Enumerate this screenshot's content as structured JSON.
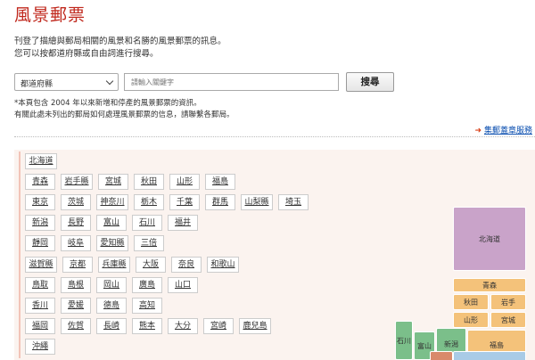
{
  "page": {
    "title": "風景郵票",
    "intro_line1": "刊登了描繪與郵局相關的風景和名勝的風景郵票的訊息。",
    "intro_line2": "您可以按都道府縣或自由詞進行搜尋。"
  },
  "search": {
    "select_value": "都道府縣",
    "placeholder": "請輸入關鍵字",
    "button_label": "搜尋"
  },
  "notes": {
    "line1": "*本頁包含 2004 年以來新增和停產的風景郵票的資訊。",
    "line2": "有關此處未列出的郵局如何處理風景郵票的信息，請聯繫各郵局。"
  },
  "service_link": {
    "label": "集郵蓋章服務",
    "icon": "arrow-right-icon"
  },
  "prefecture_rows": [
    [
      "北海道"
    ],
    [
      "青森",
      "岩手縣",
      "宮城",
      "秋田",
      "山形",
      "福島"
    ],
    [
      "東京",
      "茨城",
      "神奈川",
      "栃木",
      "千葉",
      "群馬",
      "山梨縣",
      "埼玉"
    ],
    [
      "新潟",
      "長野",
      "富山",
      "石川",
      "福井"
    ],
    [
      "靜岡",
      "岐阜",
      "愛知縣",
      "三倍"
    ],
    [
      "滋賀縣",
      "京都",
      "兵庫縣",
      "大阪",
      "奈良",
      "和歌山"
    ],
    [
      "鳥取",
      "島根",
      "岡山",
      "廣島",
      "山口"
    ],
    [
      "香川",
      "愛媛",
      "德島",
      "高知"
    ],
    [
      "福岡",
      "佐賀",
      "長崎",
      "熊本",
      "大分",
      "宮崎",
      "鹿兒島"
    ],
    [
      "沖繩"
    ]
  ],
  "map_regions": [
    {
      "label": "北海道",
      "color": "#c9a3c9"
    },
    {
      "label": "青森",
      "color": "#f4c27a"
    },
    {
      "label": "秋田",
      "color": "#f4c27a"
    },
    {
      "label": "岩手",
      "color": "#f4c27a"
    },
    {
      "label": "山形",
      "color": "#f4c27a"
    },
    {
      "label": "宮城",
      "color": "#f4c27a"
    },
    {
      "label": "石川",
      "color": "#7bbf8a"
    },
    {
      "label": "富山",
      "color": "#7bbf8a"
    },
    {
      "label": "新潟",
      "color": "#7bbf8a"
    },
    {
      "label": "福島",
      "color": "#f4c27a"
    },
    {
      "label": "",
      "color": "#7bbf8a"
    },
    {
      "label": "",
      "color": "#d98a6b"
    },
    {
      "label": "",
      "color": "#a9cbe6"
    }
  ]
}
